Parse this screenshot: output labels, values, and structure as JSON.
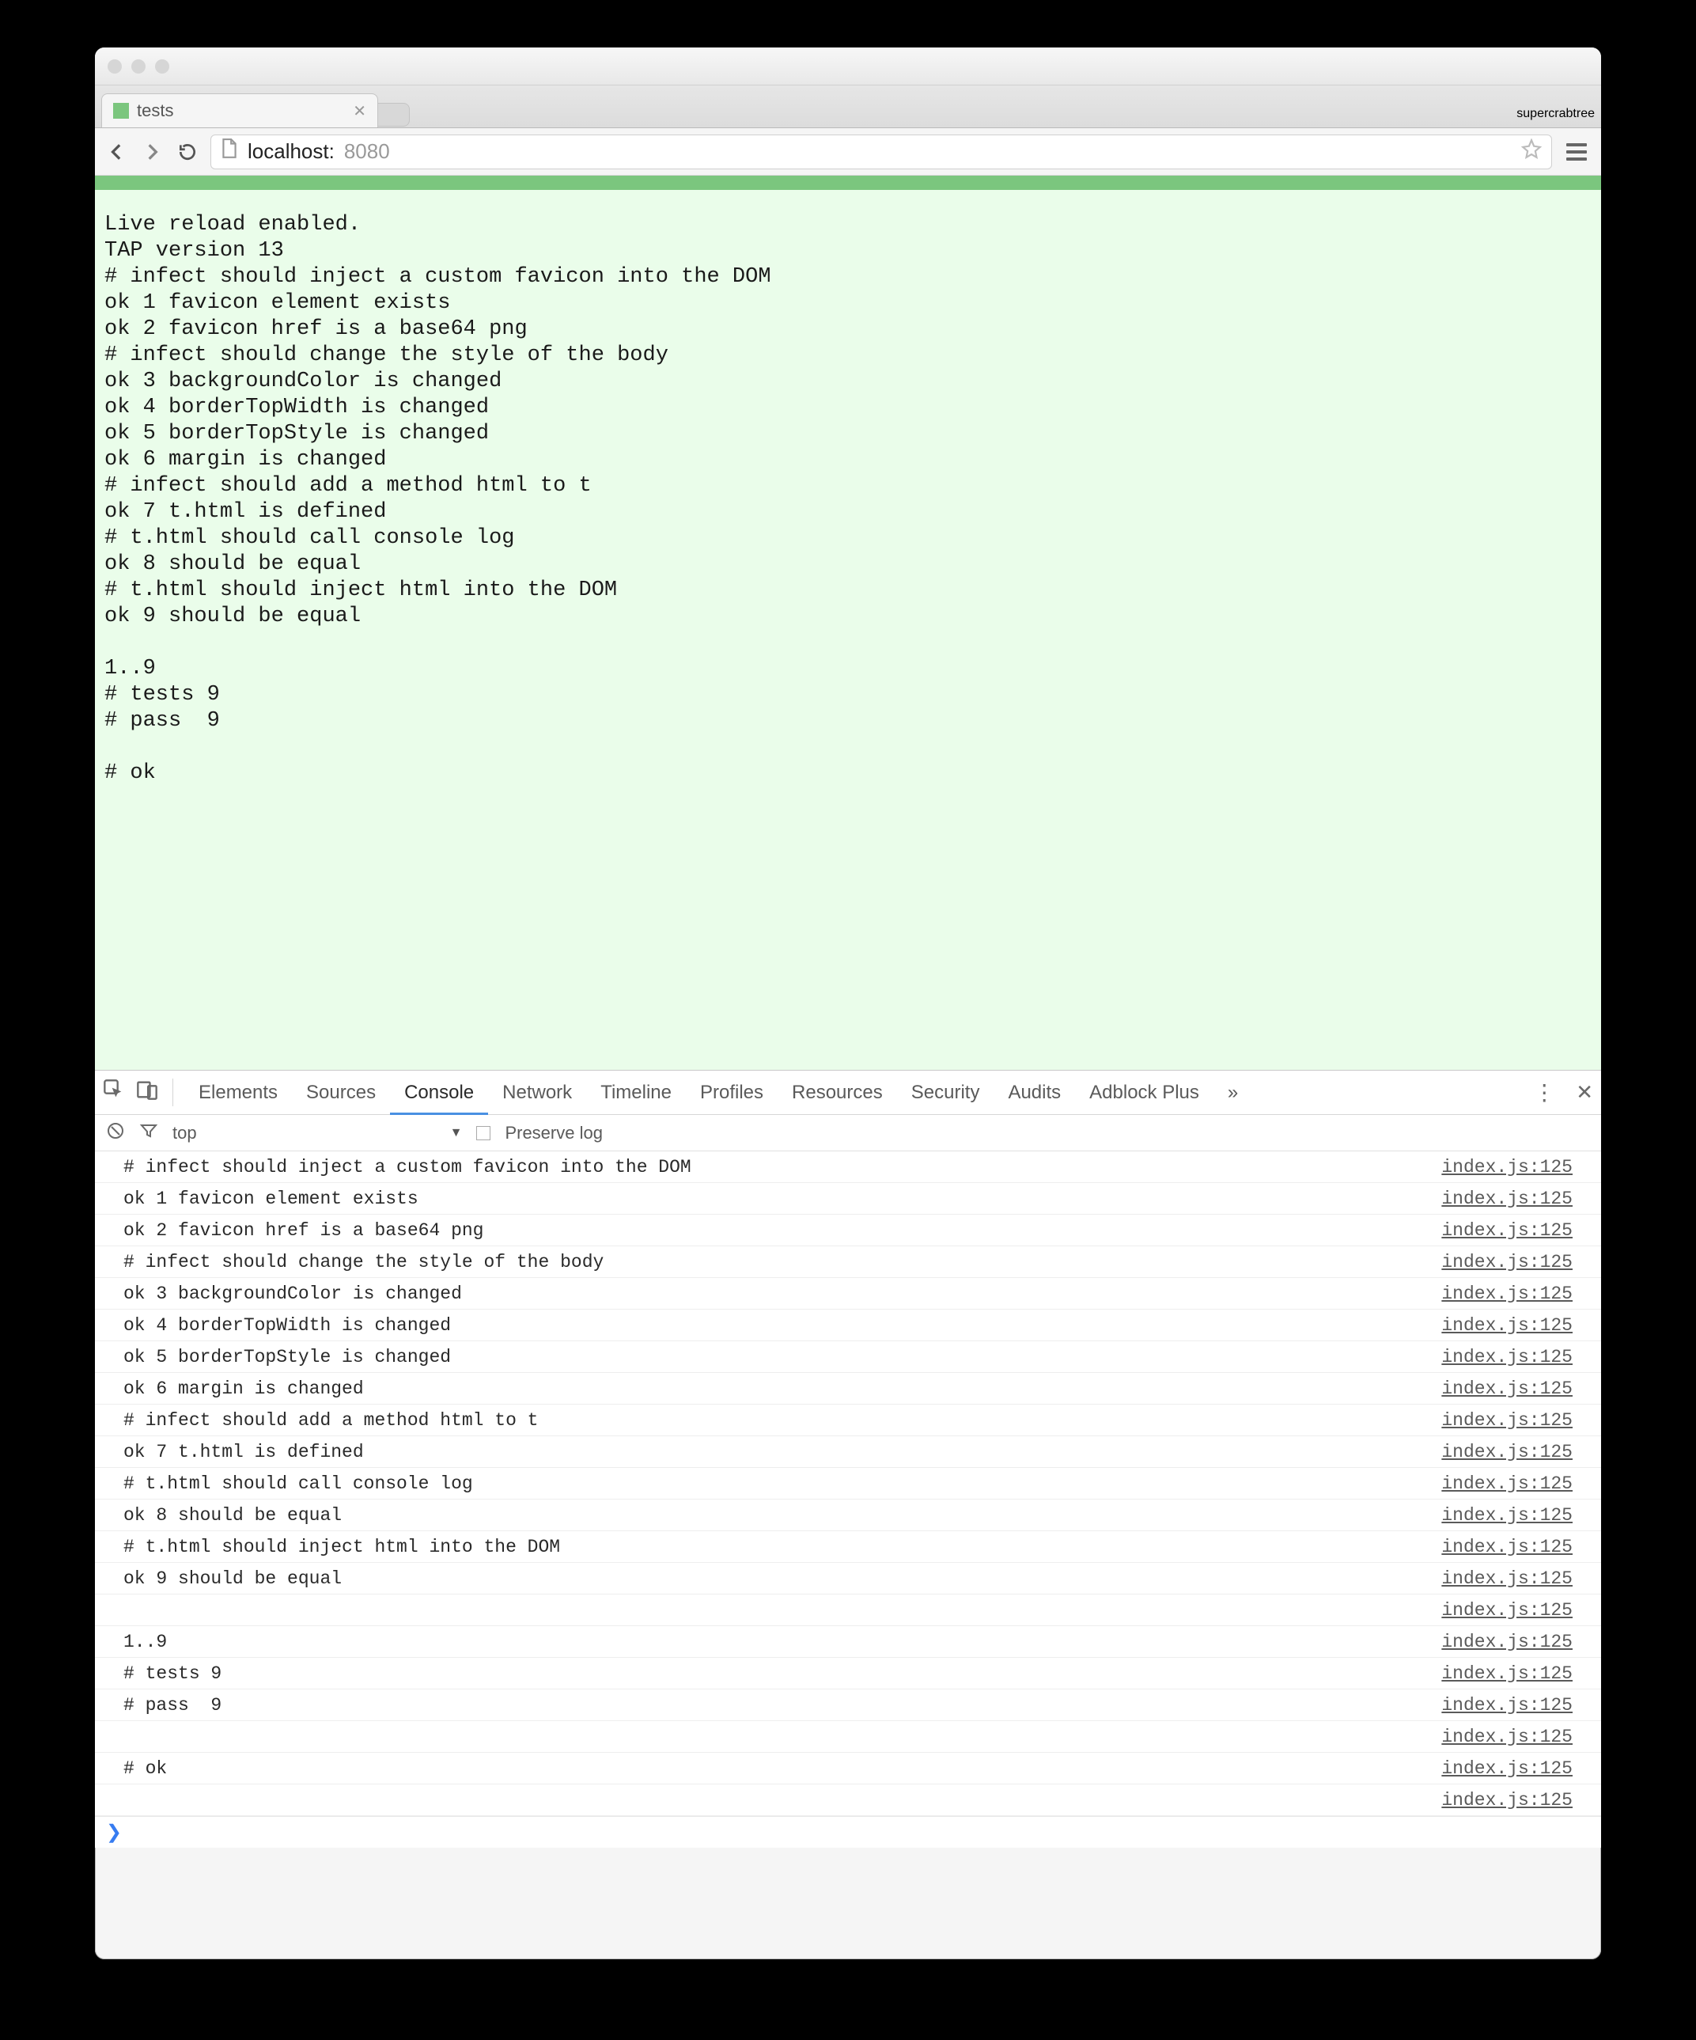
{
  "window": {
    "profile": "supercrabtree",
    "tab_title": "tests"
  },
  "nav": {
    "host": "localhost:",
    "port": "8080"
  },
  "page": {
    "accent": "#7bc67e",
    "bg": "#eafdea",
    "tap_lines": [
      "Live reload enabled.",
      "TAP version 13",
      "# infect should inject a custom favicon into the DOM",
      "ok 1 favicon element exists",
      "ok 2 favicon href is a base64 png",
      "# infect should change the style of the body",
      "ok 3 backgroundColor is changed",
      "ok 4 borderTopWidth is changed",
      "ok 5 borderTopStyle is changed",
      "ok 6 margin is changed",
      "# infect should add a method html to t",
      "ok 7 t.html is defined",
      "# t.html should call console log",
      "ok 8 should be equal",
      "# t.html should inject html into the DOM",
      "ok 9 should be equal",
      "",
      "1..9",
      "# tests 9",
      "# pass  9",
      "",
      "# ok"
    ]
  },
  "devtools": {
    "tabs": [
      "Elements",
      "Sources",
      "Console",
      "Network",
      "Timeline",
      "Profiles",
      "Resources",
      "Security",
      "Audits",
      "Adblock Plus"
    ],
    "active_tab": "Console",
    "overflow": "»",
    "filter": {
      "context": "top",
      "preserve_label": "Preserve log"
    },
    "source_label": "index.js:125",
    "log": [
      "# infect should inject a custom favicon into the DOM",
      "ok 1 favicon element exists",
      "ok 2 favicon href is a base64 png",
      "# infect should change the style of the body",
      "ok 3 backgroundColor is changed",
      "ok 4 borderTopWidth is changed",
      "ok 5 borderTopStyle is changed",
      "ok 6 margin is changed",
      "# infect should add a method html to t",
      "ok 7 t.html is defined",
      "# t.html should call console log",
      "ok 8 should be equal",
      "# t.html should inject html into the DOM",
      "ok 9 should be equal",
      "",
      "1..9",
      "# tests 9",
      "# pass  9",
      "",
      "# ok",
      ""
    ]
  }
}
